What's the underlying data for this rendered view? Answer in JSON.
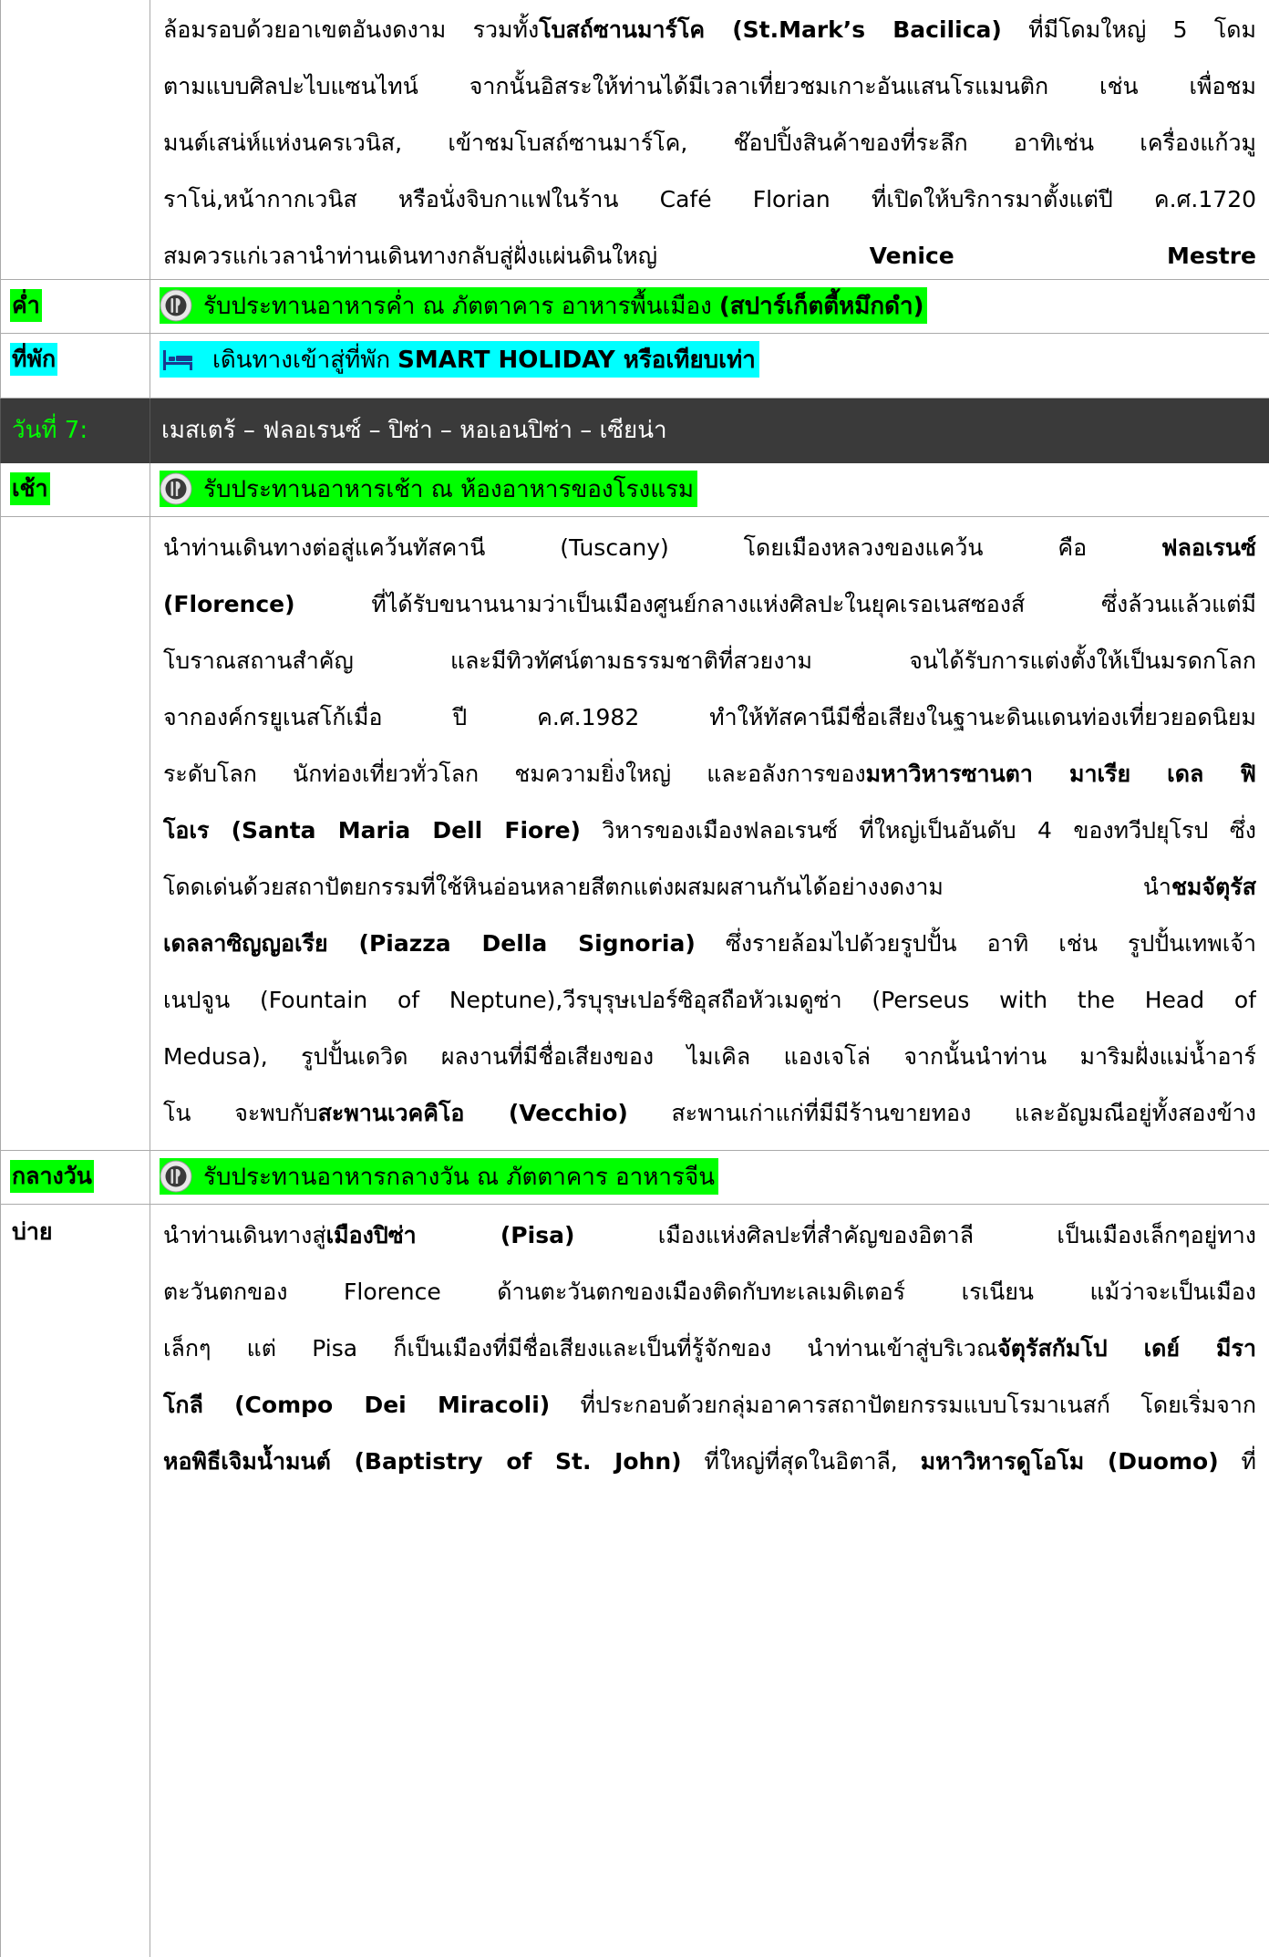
{
  "day6": {
    "continuation_lines": [
      [
        "ล้อมรอบด้วยอาเขตอันงดงาม รวมทั้ง",
        {
          "b": "โบสถ์ซานมาร์โค (St.Mark’s Bacilica)"
        },
        " ที่มีโดมใหญ่ 5 โดม"
      ],
      [
        "ตามแบบศิลปะไบแซนไทน์ จากนั้นอิสระให้ท่านได้มีเวลาเที่ยวชมเกาะอันแสนโรแมนติก เช่น เพื่อชม"
      ],
      [
        "มนต์เสน่ห์แห่งนครเวนิส, เข้าชมโบสถ์ซานมาร์โค, ช๊อปปิ้งสินค้าของที่ระลึก อาทิเช่น เครื่องแก้วมู"
      ],
      [
        "ราโน่,หน้ากากเวนิส หรือนั่งจิบกาแฟในร้าน Café Florian ที่เปิดให้บริการมาตั้งแต่ปี ค.ศ.1720"
      ],
      [
        "สมควรแก่เวลานำท่านเดินทางกลับสู่ฝั่งแผ่นดินใหญ่ ",
        {
          "b": "Venice Mestre"
        }
      ]
    ],
    "dinner_label": "ค่ำ",
    "dinner_text": "รับประทานอาหารค่ำ ณ ภัตตาคาร อาหารพื้นเมือง ",
    "dinner_bold": "(สปาร์เก็ตตี้หมึกดำ)",
    "hotel_label": "ที่พัก",
    "hotel_text": "เดินทางเข้าสู่ที่พัก ",
    "hotel_bold": "SMART HOLIDAY หรือเทียบเท่า"
  },
  "day7": {
    "day_label": "วันที่ 7:",
    "route": "เมสเตร้ – ฟลอเรนซ์ – ปิซ่า – หอเอนปิซ่า – เซียน่า",
    "breakfast_label": "เช้า",
    "breakfast_text": "รับประทานอาหารเช้า ณ ห้องอาหารของโรงแรม",
    "morning_lines": [
      [
        "นำท่านเดินทางต่อสู่แคว้นทัสคานี (Tuscany)    โดยเมืองหลวงของแคว้น คือ   ",
        {
          "b": "ฟลอเรนซ์"
        }
      ],
      [
        {
          "b": "(Florence)"
        },
        " ที่ได้รับขนานนามว่าเป็นเมืองศูนย์กลางแห่งศิลปะในยุคเรอเนสซองส์ ซึ่งล้วนแล้วแต่มี"
      ],
      [
        "โบราณสถานสำคัญ และมีทิวทัศน์ตามธรรมชาติที่สวยงาม จนได้รับการแต่งตั้งให้เป็นมรดกโลก"
      ],
      [
        "จากองค์กรยูเนสโก้เมื่อ ปี ค.ศ.1982 ทำให้ทัสคานีมีชื่อเสียงในฐานะดินแดนท่องเที่ยวยอดนิยม"
      ],
      [
        "ระดับโลก นักท่องเที่ยวทั่วโลก ชมความยิ่งใหญ่ และอลังการของ",
        {
          "b": "มหาวิหารซานตา มาเรีย เดล ฟิ"
        }
      ],
      [
        {
          "b": "โอเร (Santa Maria Dell Fiore)"
        },
        " วิหารของเมืองฟลอเรนซ์ ที่ใหญ่เป็นอันดับ 4 ของทวีปยุโรป ซึ่ง"
      ],
      [
        "โดดเด่นด้วยสถาปัตยกรรมที่ใช้หินอ่อนหลายสีตกแต่งผสมผสานกันได้อย่างงดงาม นำ",
        {
          "b": "ชมจัตุรัส"
        }
      ],
      [
        {
          "b": "เดลลาซิญญอเรีย (Piazza  Della  Signoria)"
        },
        " ซึ่งรายล้อมไปด้วยรูปปั้น อาทิ เช่น รูปปั้นเทพเจ้า"
      ],
      [
        "เนปจูน (Fountain  of  Neptune),วีรบุรุษเปอร์ซิอุสถือหัวเมดูซ่า (Perseus  with  the  Head  of"
      ],
      [
        "Medusa), รูปปั้นเดวิด ผลงานที่มีชื่อเสียงของ ไมเคิล แองเจโล่ จากนั้นนำท่าน มาริมฝั่งแม่น้ำอาร์"
      ],
      [
        "โน จะพบกับ",
        {
          "b": "สะพานเวคคิโอ (Vecchio)"
        },
        " สะพานเก่าแก่ที่มีมีร้านขายทอง และอัญมณีอยู่ทั้งสองข้าง"
      ]
    ],
    "lunch_label": "กลางวัน",
    "lunch_text": "รับประทานอาหารกลางวัน ณ ภัตตาคาร อาหารจีน",
    "afternoon_label": "บ่าย",
    "afternoon_lines": [
      [
        "นำท่านเดินทางสู่",
        {
          "b": "เมืองปิซ่า  (Pisa)"
        },
        "  เมืองแห่งศิลปะที่สำคัญของอิตาลี  เป็นเมืองเล็กๆอยู่ทาง"
      ],
      [
        "ตะวันตกของ  Florence  ด้านตะวันตกของเมืองติดกับทะเลเมดิเตอร์  เรเนียน  แม้ว่าจะเป็นเมือง"
      ],
      [
        "เล็กๆ แต่ Pisa ก็เป็นเมืองที่มีชื่อเสียงและเป็นที่รู้จักของ นำท่านเข้าสู่บริเวณ",
        {
          "b": "จัตุรัสกัมโป เดย์ มีรา"
        }
      ],
      [
        {
          "b": "โกลี (Compo Dei Miracoli)"
        },
        " ที่ประกอบด้วยกลุ่มอาคารสถาปัตยกรรมแบบโรมาเนสก์ โดยเริ่มจาก"
      ],
      [
        {
          "b": "หอพิธีเจิมน้ำมนต์ (Baptistry of St. John)"
        },
        " ที่ใหญ่ที่สุดในอิตาลี, ",
        {
          "b": "มหาวิหารดูโอโม (Duomo)"
        },
        " ที่"
      ]
    ]
  },
  "colors": {
    "highlight_green": "#00ff00",
    "highlight_cyan": "#00ffff",
    "day_header_bg": "#3a3a3a",
    "day_header_text": "#00ff00"
  },
  "icons": {
    "meal": "fork-knife-icon",
    "hotel": "bed-icon"
  }
}
